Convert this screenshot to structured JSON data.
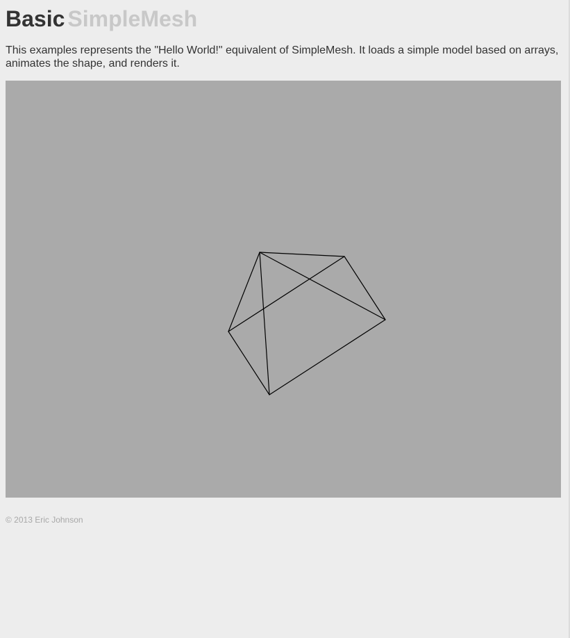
{
  "header": {
    "title_primary": "Basic",
    "title_secondary": "SimpleMesh"
  },
  "intro": {
    "text": "This examples represents the \"Hello World!\" equivalent of SimpleMesh. It loads a simple model based on arrays, animates the shape, and renders it."
  },
  "canvas": {
    "background_color": "#aaaaaa",
    "wireframe_color": "#000000"
  },
  "footer": {
    "copyright": "© 2013 Eric Johnson"
  },
  "colors": {
    "page_background": "#ededed",
    "text": "#333333",
    "title_secondary": "#c8c8c8",
    "footer_text": "#a8a8a8"
  }
}
